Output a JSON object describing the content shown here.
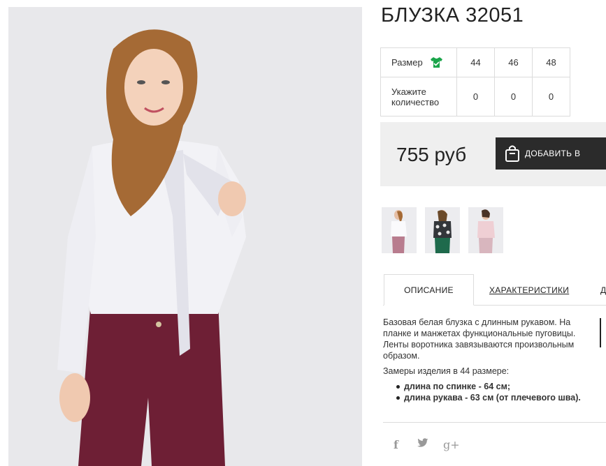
{
  "product": {
    "title": "БЛУЗКА 32051",
    "price": "755 руб",
    "add_to_cart_label": "ДОБАВИТЬ В"
  },
  "size_table": {
    "size_label": "Размер",
    "quantity_label": "Укажите количество",
    "sizes": [
      "44",
      "46",
      "48"
    ],
    "quantities": [
      "0",
      "0",
      "0"
    ]
  },
  "icons": {
    "size_icon": "green-shirt-check-icon",
    "cart_icon": "shopping-bag-icon"
  },
  "tabs": [
    {
      "label": "ОПИСАНИЕ",
      "active": true
    },
    {
      "label": "ХАРАКТЕРИСТИКИ",
      "active": false
    },
    {
      "label": "Д",
      "active": false
    }
  ],
  "description": {
    "paragraph": "Базовая белая блузка с длинным рукавом. На планке и манжетах функциональные пуговицы. Ленты воротника завязываются произвольным образом.",
    "measures_intro": "Замеры изделия в 44 размере:",
    "measures": [
      "длина по спинке - 64 см;",
      "длина рукава - 63 см (от плечевого шва)."
    ]
  },
  "social": {
    "facebook": "f",
    "twitter": "🐦",
    "googleplus": "g+"
  },
  "colors": {
    "accent_green": "#1aa54a",
    "button_dark": "#2b2b2b",
    "buy_box_bg": "#efefef"
  }
}
